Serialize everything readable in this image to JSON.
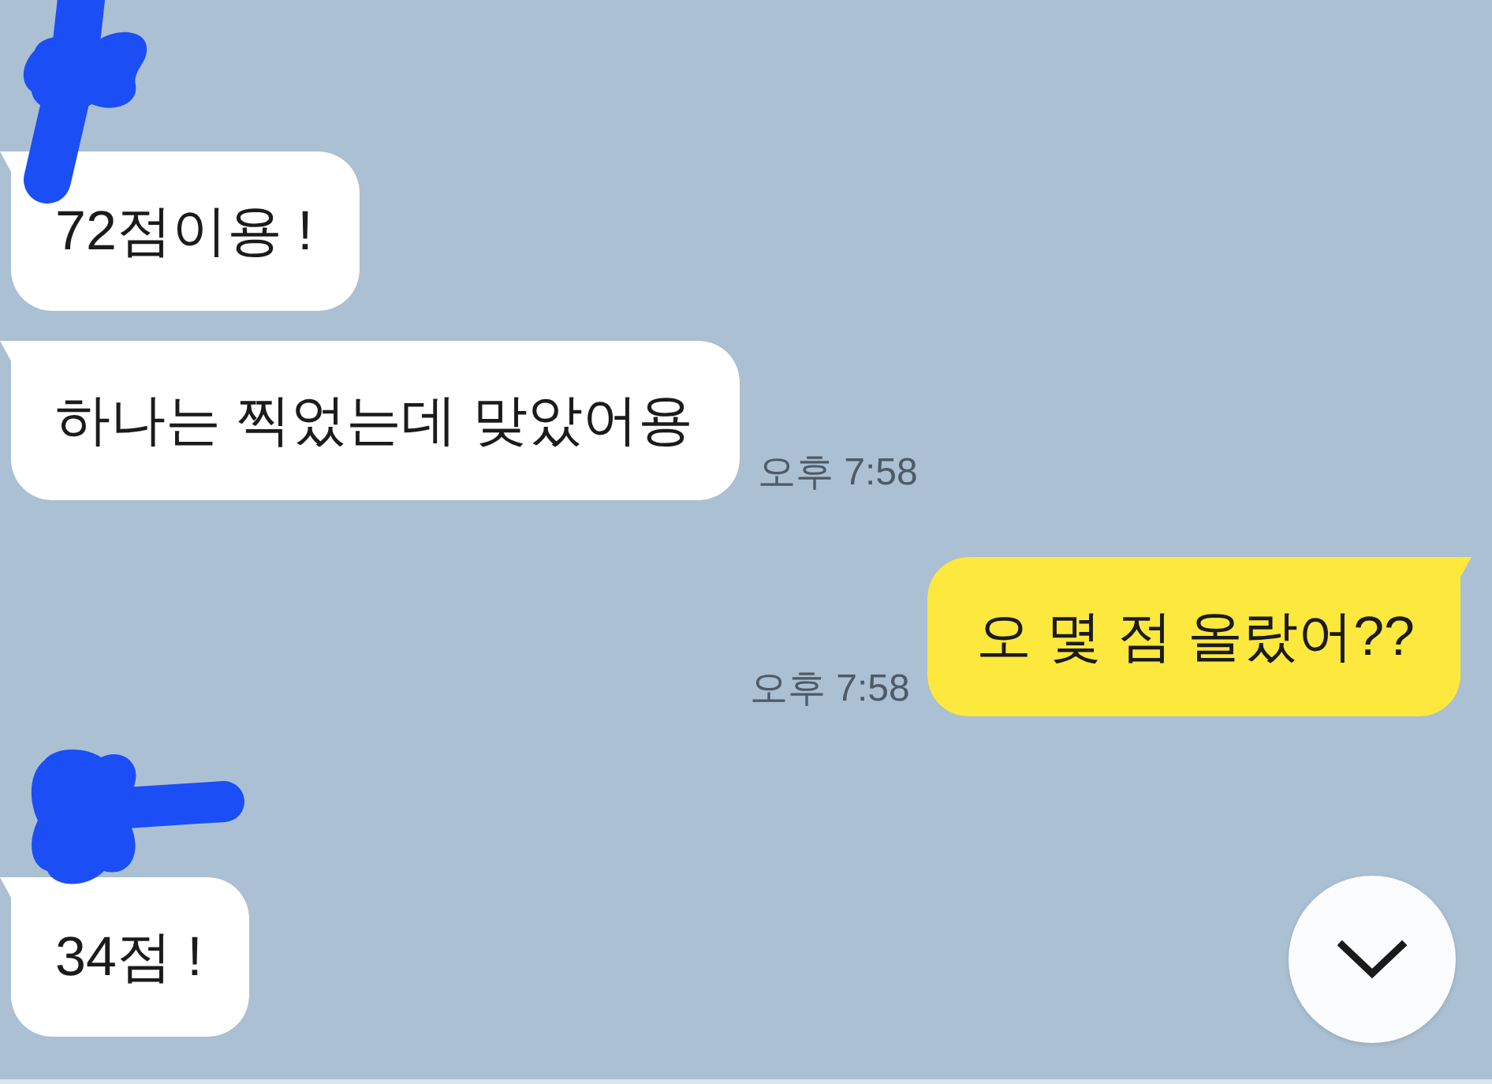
{
  "chat": {
    "groups": [
      {
        "kind": "received",
        "sender_redacted": true,
        "messages": [
          {
            "text": "72점이용 !"
          },
          {
            "text": "하나는 찍었는데 맞았어용",
            "time": "오후 7:58"
          }
        ]
      },
      {
        "kind": "sent",
        "messages": [
          {
            "text": "오 몇 점 올랐어??",
            "time": "오후 7:58"
          }
        ]
      },
      {
        "kind": "received",
        "sender_redacted": true,
        "messages": [
          {
            "text": "34점 !"
          }
        ]
      }
    ]
  }
}
